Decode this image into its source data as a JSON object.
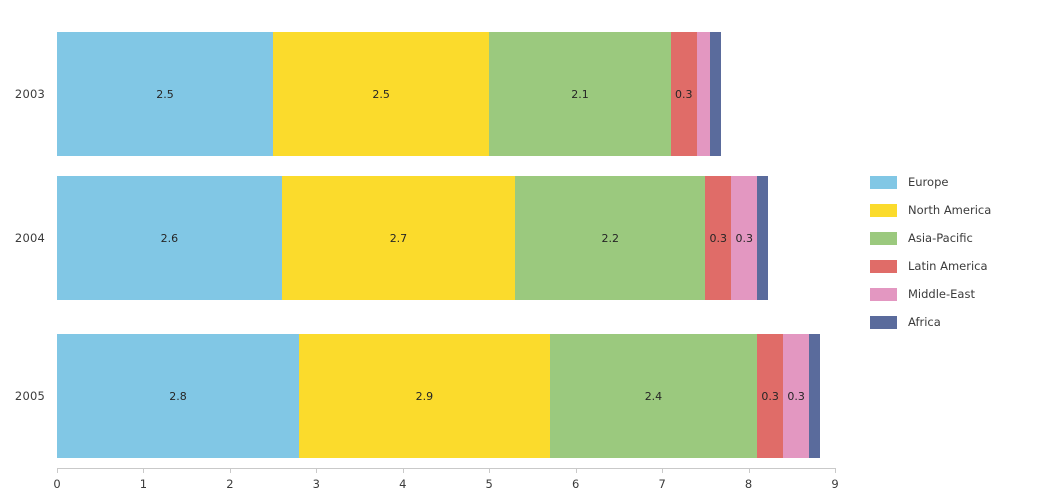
{
  "chart_data": {
    "type": "bar",
    "orientation": "horizontal",
    "stacked": true,
    "title": "",
    "subtitle": "",
    "xlabel": "",
    "ylabel": "",
    "xlim": [
      0,
      9
    ],
    "ylim": null,
    "grid": false,
    "legend_position": "right",
    "x_ticks": [
      "0",
      "1",
      "2",
      "3",
      "4",
      "5",
      "6",
      "7",
      "8",
      "9"
    ],
    "x_tick_values": [
      0,
      1,
      2,
      3,
      4,
      5,
      6,
      7,
      8,
      9
    ],
    "categories": [
      "2003",
      "2004",
      "2005"
    ],
    "series": [
      {
        "name": "Europe",
        "color": "#81c7e5",
        "values": [
          2.5,
          2.6,
          2.8
        ],
        "labels": [
          "2.5",
          "2.6",
          "2.8"
        ]
      },
      {
        "name": "North America",
        "color": "#fbdb2c",
        "values": [
          2.5,
          2.7,
          2.9
        ],
        "labels": [
          "2.5",
          "2.7",
          "2.9"
        ]
      },
      {
        "name": "Asia-Pacific",
        "color": "#9bc97e",
        "values": [
          2.1,
          2.2,
          2.4
        ],
        "labels": [
          "2.1",
          "2.2",
          "2.4"
        ]
      },
      {
        "name": "Latin America",
        "color": "#e06c68",
        "values": [
          0.3,
          0.3,
          0.3
        ],
        "labels": [
          "0.3",
          "0.3",
          "0.3"
        ]
      },
      {
        "name": "Middle-East",
        "color": "#e397c1",
        "values": [
          0.15,
          0.3,
          0.3
        ],
        "labels": [
          "",
          "0.3",
          "0.3"
        ]
      },
      {
        "name": "Africa",
        "color": "#5a6b9c",
        "values": [
          0.13,
          0.13,
          0.13
        ],
        "labels": [
          "",
          "",
          ""
        ]
      }
    ],
    "totals": [
      7.68,
      8.23,
      8.83
    ]
  },
  "legend": {
    "items": [
      {
        "label": "Europe",
        "color": "#81c7e5"
      },
      {
        "label": "North America",
        "color": "#fbdb2c"
      },
      {
        "label": "Asia-Pacific",
        "color": "#9bc97e"
      },
      {
        "label": "Latin America",
        "color": "#e06c68"
      },
      {
        "label": "Middle-East",
        "color": "#e397c1"
      },
      {
        "label": "Africa",
        "color": "#5a6b9c"
      }
    ]
  }
}
